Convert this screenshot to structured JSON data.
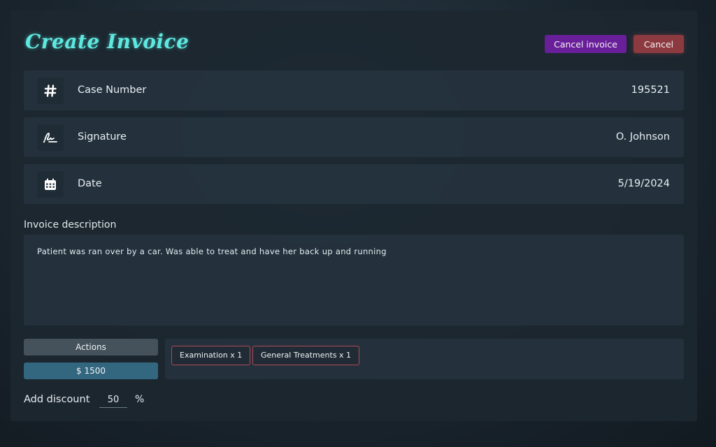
{
  "header": {
    "title": "Create Invoice",
    "cancel_invoice_label": "Cancel invoice",
    "cancel_label": "Cancel"
  },
  "fields": {
    "case": {
      "icon": "hash-icon",
      "label": "Case Number",
      "value": "195521"
    },
    "signature": {
      "icon": "signature-icon",
      "label": "Signature",
      "value": "O. Johnson"
    },
    "date": {
      "icon": "calendar-icon",
      "label": "Date",
      "value": "5/19/2024"
    }
  },
  "description": {
    "label": "Invoice description",
    "value": "Patient was ran over by a car. Was able to treat and have her back up and running"
  },
  "actions": {
    "actions_label": "Actions",
    "total_label": "$ 1500"
  },
  "items": [
    {
      "label": "Examination x 1"
    },
    {
      "label": "General Treatments x 1"
    }
  ],
  "discount": {
    "label": "Add discount",
    "value": "50",
    "unit": "%"
  },
  "colors": {
    "title_accent": "#5ee8e0",
    "cancel_invoice_bg": "#6a1f9a",
    "cancel_bg": "#8c3a40",
    "price_bar_bg": "#33677f",
    "tag_border": "#b04a55"
  }
}
